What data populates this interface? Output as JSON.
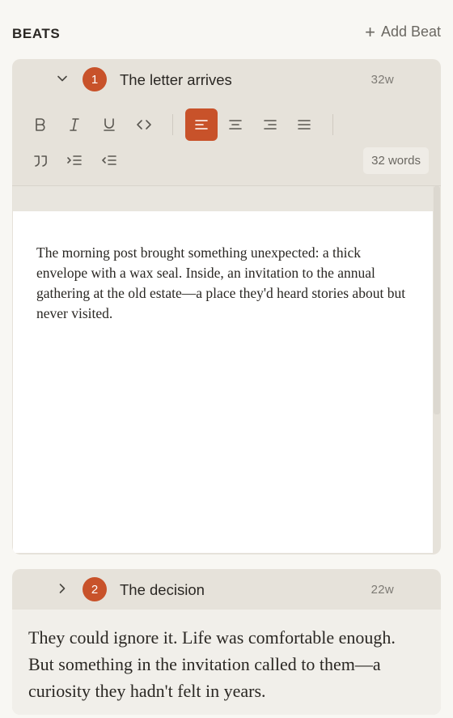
{
  "header": {
    "title": "BEATS",
    "add_label": "Add Beat",
    "add_icon": "plus-icon"
  },
  "colors": {
    "accent": "#c8522a",
    "card_bg": "#e6e2da",
    "page_bg": "#f8f7f3"
  },
  "beats": [
    {
      "number": "1",
      "title": "The letter arrives",
      "count": "32w",
      "expanded": true,
      "word_count_label": "32 words",
      "text": "The morning post brought something unexpected: a thick envelope with a wax seal. Inside, an invitation to the annual gathering at the old estate—a place they'd heard stories about but never visited."
    },
    {
      "number": "2",
      "title": "The decision",
      "count": "22w",
      "expanded": false,
      "text": "They could ignore it. Life was comfortable enough. But something in the invitation called to them—a curiosity they hadn't felt in years."
    }
  ],
  "toolbar": {
    "buttons": [
      {
        "name": "bold",
        "icon": "bold-icon",
        "active": false
      },
      {
        "name": "italic",
        "icon": "italic-icon",
        "active": false
      },
      {
        "name": "underline",
        "icon": "underline-icon",
        "active": false
      },
      {
        "name": "code",
        "icon": "code-icon",
        "active": false
      },
      {
        "name": "align-left",
        "icon": "align-left-icon",
        "active": true
      },
      {
        "name": "align-center",
        "icon": "align-center-icon",
        "active": false
      },
      {
        "name": "align-right",
        "icon": "align-right-icon",
        "active": false
      },
      {
        "name": "align-justify",
        "icon": "align-justify-icon",
        "active": false
      },
      {
        "name": "blockquote",
        "icon": "quote-icon",
        "active": false
      },
      {
        "name": "indent",
        "icon": "indent-icon",
        "active": false
      },
      {
        "name": "outdent",
        "icon": "outdent-icon",
        "active": false
      }
    ]
  }
}
